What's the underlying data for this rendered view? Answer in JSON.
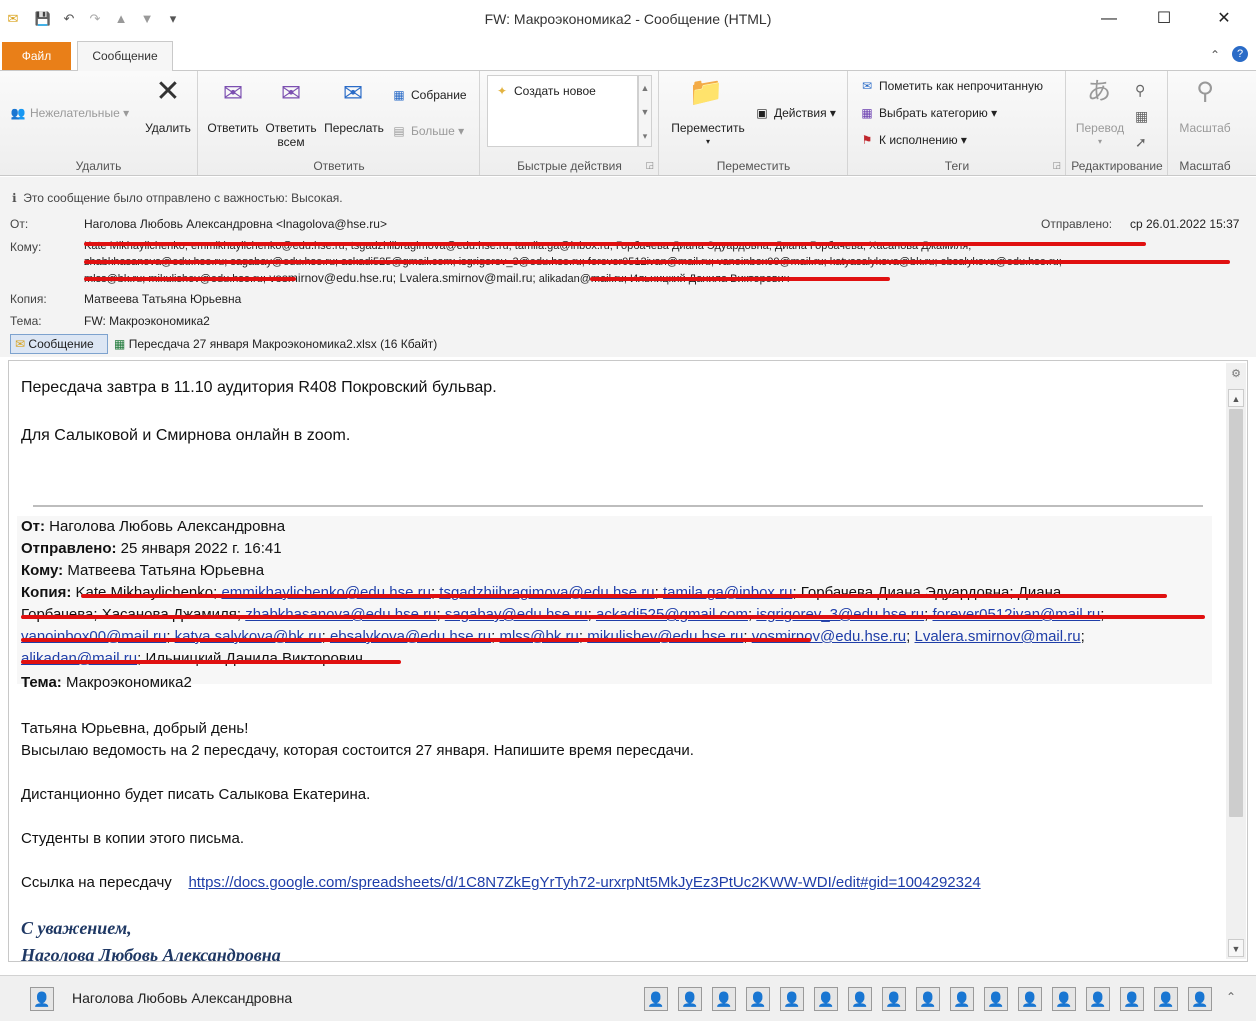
{
  "window": {
    "title": "FW: Макроэкономика2 - Сообщение (HTML)",
    "minimize": "—",
    "maximize": "☐",
    "close": "✕"
  },
  "tabs": {
    "file": "Файл",
    "message": "Сообщение"
  },
  "ribbon": {
    "delete_group": {
      "label": "Удалить",
      "junk": "Нежелательные",
      "delete": "Удалить"
    },
    "respond_group": {
      "label": "Ответить",
      "reply": "Ответить",
      "reply_all_1": "Ответить",
      "reply_all_2": "всем",
      "forward": "Переслать",
      "meeting": "Собрание",
      "more": "Больше"
    },
    "quick_group": {
      "label": "Быстрые действия",
      "create_new": "Создать новое"
    },
    "move_group": {
      "label": "Переместить",
      "move": "Переместить",
      "actions": "Действия"
    },
    "tags_group": {
      "label": "Теги",
      "mark_unread": "Пометить как непрочитанную",
      "categorize": "Выбрать категорию",
      "followup": "К исполнению"
    },
    "edit_group": {
      "label": "Редактирование",
      "translate": "Перевод"
    },
    "zoom_group": {
      "label": "Масштаб",
      "zoom": "Масштаб"
    }
  },
  "header": {
    "importance": "Это сообщение было отправлено с важностью: Высокая.",
    "from_label": "От:",
    "from_value": "Наголова Любовь Александровна <lnagolova@hse.ru>",
    "sent_label": "Отправлено:",
    "sent_value": "ср 26.01.2022 15:37",
    "to_label": "Кому:",
    "to_line1": "Kate Mikhaylichenko; emmikhaylichenko@edu.hse.ru; tsgadzhiibragimova@edu.hse.ru; tamila.ga@inbox.ru; Горбачева Диана Эдуардовна; Диана Горбачева; Хасанова Джамиля;",
    "to_line2": "zhabkhasanova@edu.hse.ru; sagabay@edu.hse.ru; ackadi525@gmail.com; isgrigorev_3@edu.hse.ru; forever0512ivan@mail.ru; vanoinbox00@mail.ru; katyasalykova@bk.ru; ebsalykova@edu.hse.ru;",
    "to_line3a": "mlss@bk.ru; mikulishev@edu.hse.ru;",
    "to_line3b": " vosmirnov@edu.hse.ru; Lvalera.smirnov@mail.ru;",
    "to_line3c": " alikadan@mail.ru; Ильницкий Данила Викторович",
    "cc_label": "Копия:",
    "cc_value": "Матвеева Татьяна Юрьевна",
    "subject_label": "Тема:",
    "subject_value": "FW: Макроэкономика2"
  },
  "attachments": {
    "message_tab": "Сообщение",
    "file": "Пересдача 27 января Макроэкономика2.xlsx (16 Кбайт)"
  },
  "body": {
    "line1": "Пересдача завтра в 11.10 аудитория R408 Покровский бульвар.",
    "line2": "Для Салыковой и Смирнова онлайн в zoom.",
    "fwd_from_label": "От:",
    "fwd_from": " Наголова Любовь Александровна",
    "fwd_sent_label": "Отправлено:",
    "fwd_sent": " 25 января 2022 г. 16:41",
    "fwd_to_label": "Кому:",
    "fwd_to": " Матвеева Татьяна Юрьевна",
    "fwd_cc_label": "Копия:",
    "fwd_cc_l1a": " Kate Mikhaylichenko; ",
    "fwd_cc_l1b": "emmikhaylichenko@edu.hse.ru",
    "fwd_cc_l1c": "tsgadzhiibragimova@edu.hse.ru",
    "fwd_cc_l1d": "tamila.ga@inbox.ru",
    "fwd_cc_l1e": "; Горбачева Диана Эдуардовна; Диана",
    "fwd_cc_l2a": "Горбачева; Хасанова Джамиля; ",
    "fwd_cc_l2b": "zhabkhasanova@edu.hse.ru",
    "fwd_cc_l2c": "sagabay@edu.hse.ru",
    "fwd_cc_l2d": "ackadi525@gmail.com",
    "fwd_cc_l2e": "isgrigorev_3@edu.hse.ru",
    "fwd_cc_l2f": "forever0512ivan@mail.ru",
    "fwd_cc_l3a": "vanoinbox00@mail.ru",
    "fwd_cc_l3b": "katya.salykova@bk.ru",
    "fwd_cc_l3c": "ebsalykova@edu.hse.ru",
    "fwd_cc_l3d": "mlss@bk.ru",
    "fwd_cc_l3e": "mikulishev@edu.hse.ru",
    "fwd_cc_l3f": "vosmirnov@edu.hse.ru",
    "fwd_cc_l3g": "Lvalera.smirnov@mail.ru",
    "fwd_cc_l4a": "alikadan@mail.ru",
    "fwd_cc_l4b": "; Ильницкий Данила Викторович",
    "fwd_subject_label": "Тема:",
    "fwd_subject": " Макроэкономика2",
    "greeting": "Татьяна Юрьевна, добрый день!",
    "p1": "Высылаю ведомость на 2 пересдачу, которая состоится 27 января. Напишите время пересдачи.",
    "p2": "Дистанционно будет писать Салыкова Екатерина.",
    "p3": "Студенты в копии этого письма.",
    "link_label": "Ссылка на пересдачу",
    "link": "https://docs.google.com/spreadsheets/d/1C8N7ZkEgYrTyh72-urxrpNt5MkJyEz3PtUc2KWW-WDI/edit#gid=1004292324",
    "sig1": "С уважением,",
    "sig2": "Наголова Любовь Александровна"
  },
  "people_pane": {
    "name": "Наголова Любовь Александровна"
  },
  "colors": {
    "file_tab": "#e97f18",
    "link": "#1f3ea8",
    "redaction": "#e01010",
    "signature": "#1f3864"
  }
}
